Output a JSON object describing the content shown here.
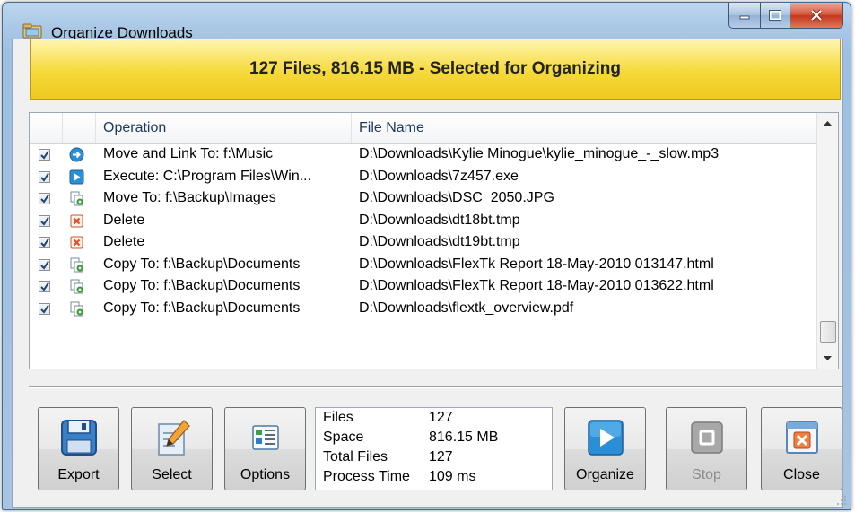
{
  "window": {
    "title": "Organize Downloads"
  },
  "banner": {
    "text": "127 Files, 816.15 MB - Selected for Organizing"
  },
  "list": {
    "columns": {
      "operation": "Operation",
      "file_name": "File Name"
    },
    "rows": [
      {
        "checked": true,
        "icon": "move-link-icon",
        "operation": "Move and Link To: f:\\Music",
        "file_name": "D:\\Downloads\\Kylie Minogue\\kylie_minogue_-_slow.mp3"
      },
      {
        "checked": true,
        "icon": "execute-icon",
        "operation": "Execute: C:\\Program Files\\Win...",
        "file_name": "D:\\Downloads\\7z457.exe"
      },
      {
        "checked": true,
        "icon": "move-icon",
        "operation": "Move To: f:\\Backup\\Images",
        "file_name": "D:\\Downloads\\DSC_2050.JPG"
      },
      {
        "checked": true,
        "icon": "delete-icon",
        "operation": "Delete",
        "file_name": "D:\\Downloads\\dt18bt.tmp"
      },
      {
        "checked": true,
        "icon": "delete-icon",
        "operation": "Delete",
        "file_name": "D:\\Downloads\\dt19bt.tmp"
      },
      {
        "checked": true,
        "icon": "copy-icon",
        "operation": "Copy To: f:\\Backup\\Documents",
        "file_name": "D:\\Downloads\\FlexTk Report 18-May-2010 013147.html"
      },
      {
        "checked": true,
        "icon": "copy-icon",
        "operation": "Copy To: f:\\Backup\\Documents",
        "file_name": "D:\\Downloads\\FlexTk Report 18-May-2010 013622.html"
      },
      {
        "checked": true,
        "icon": "copy-icon",
        "operation": "Copy To: f:\\Backup\\Documents",
        "file_name": "D:\\Downloads\\flextk_overview.pdf"
      }
    ]
  },
  "buttons": {
    "export": "Export",
    "select": "Select",
    "options": "Options",
    "organize": "Organize",
    "stop": "Stop",
    "close": "Close"
  },
  "stats": [
    {
      "label": "Files",
      "value": "127"
    },
    {
      "label": "Space",
      "value": "816.15 MB"
    },
    {
      "label": "Total Files",
      "value": "127"
    },
    {
      "label": "Process Time",
      "value": "109 ms"
    }
  ],
  "colors": {
    "banner": "#f5d93a",
    "accent": "#2a8fd6",
    "delete": "#e0502a",
    "copy": "#3a9a3a"
  }
}
